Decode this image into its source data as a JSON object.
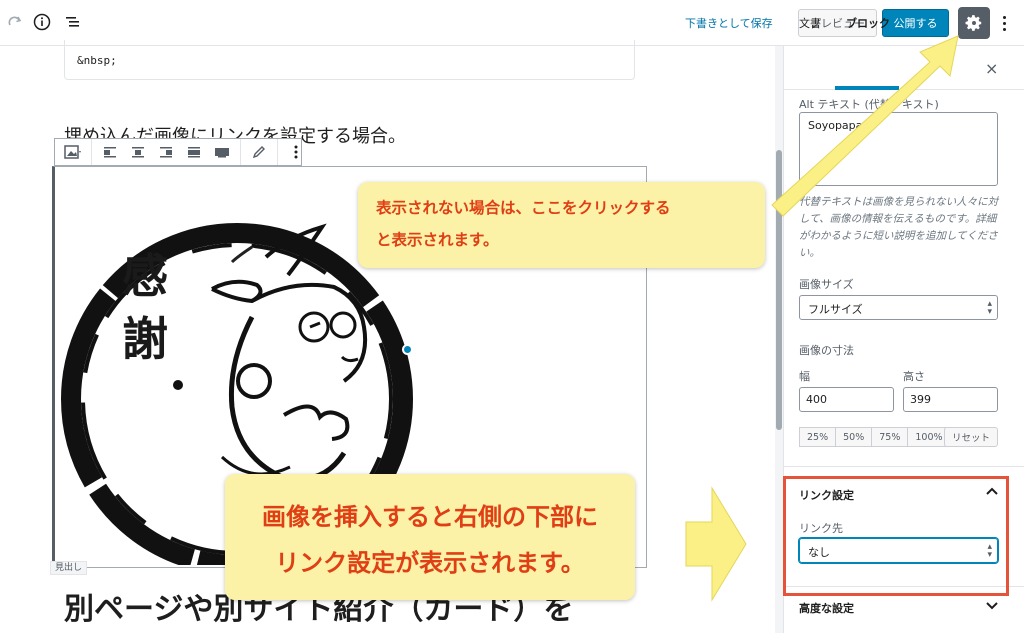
{
  "topbar": {
    "draft_label": "下書きとして保存",
    "preview_label": "プレビュー",
    "publish_label": "公開する"
  },
  "editor": {
    "code_text": "&nbsp;",
    "paragraph": "埋め込んだ画像にリンクを設定する場合。",
    "heading_tag": "見出し",
    "heading": "別ページや別サイト紹介（カード）を"
  },
  "sidebar": {
    "tabs": [
      "文書",
      "ブロック"
    ],
    "close": "×",
    "alt_label": "Alt テキスト (代替テキスト)",
    "alt_value": "Soyopapa",
    "alt_help": "代替テキストは画像を見られない人々に対して、画像の情報を伝えるものです。詳細がわかるように短い説明を追加してください。",
    "size_label": "画像サイズ",
    "size_value": "フルサイズ",
    "dims_label": "画像の寸法",
    "width_label": "幅",
    "height_label": "高さ",
    "width_value": "400",
    "height_value": "399",
    "pct_buttons": [
      "25%",
      "50%",
      "75%",
      "100%"
    ],
    "reset_label": "リセット",
    "link_panel_title": "リンク設定",
    "link_to_label": "リンク先",
    "link_to_value": "なし",
    "advanced_title": "高度な設定"
  },
  "annotations": {
    "callout_top": [
      "表示されない場合は、ここをクリックする",
      "と表示されます。"
    ],
    "callout_bottom": [
      "画像を挿入すると右側の下部に",
      "リンク設定が表示されます。"
    ]
  },
  "colors": {
    "accent": "#0085ba",
    "callout_bg": "#fbf2a8",
    "callout_text": "#e03e14",
    "highlight_box": "#e5533b"
  }
}
